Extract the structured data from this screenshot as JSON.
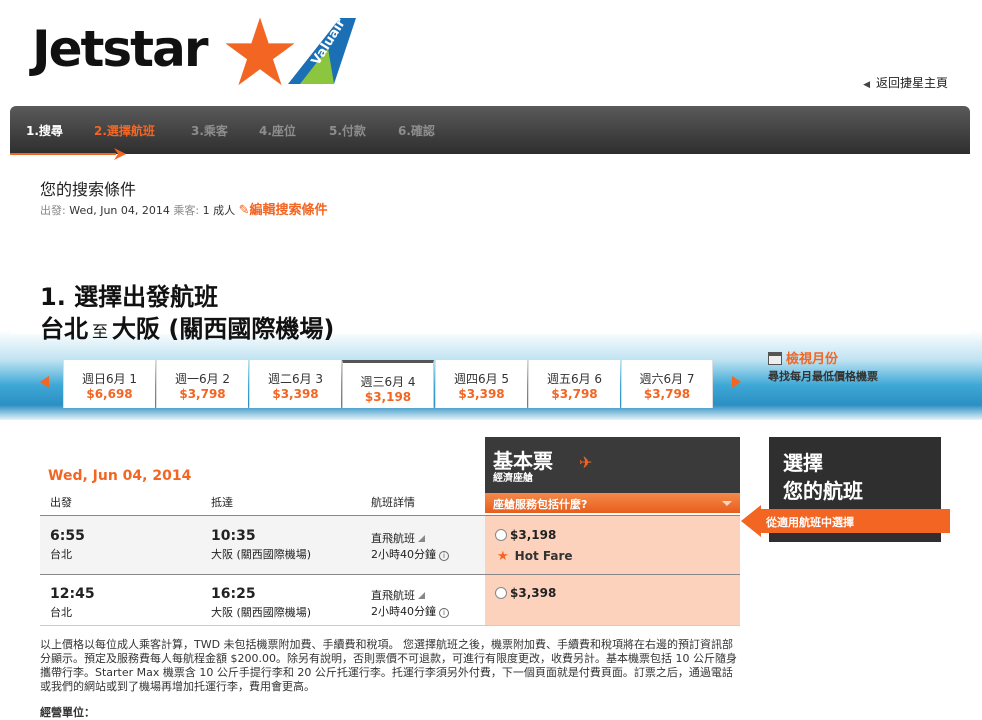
{
  "header": {
    "logo_text": "Jetstar",
    "partner_logo_text": "Valuair",
    "back_home": "返回捷星主頁"
  },
  "steps": [
    {
      "label": "1.搜尋",
      "state": "done"
    },
    {
      "label": "2.選擇航班",
      "state": "active"
    },
    {
      "label": "3.乘客",
      "state": "inactive"
    },
    {
      "label": "4.座位",
      "state": "inactive"
    },
    {
      "label": "5.付款",
      "state": "inactive"
    },
    {
      "label": "6.確認",
      "state": "inactive"
    }
  ],
  "search": {
    "title": "您的搜索條件",
    "depart_label": "出發:",
    "depart_value": "Wed, Jun 04, 2014",
    "pax_label": "乘客:",
    "pax_value": "1 成人",
    "edit_label": "編輯搜索條件"
  },
  "heading": {
    "line1": "1. 選擇出發航班",
    "origin": "台北",
    "to": "至",
    "destination": "大阪 (關西國際機場)"
  },
  "month_view": {
    "link": "檢視月份",
    "sub": "尋找每月最低價格機票"
  },
  "date_tabs": [
    {
      "day": "週日6月 1",
      "price": "$6,698"
    },
    {
      "day": "週一6月 2",
      "price": "$3,798"
    },
    {
      "day": "週二6月 3",
      "price": "$3,398"
    },
    {
      "day": "週三6月 4",
      "price": "$3,198",
      "selected": true
    },
    {
      "day": "週四6月 5",
      "price": "$3,398"
    },
    {
      "day": "週五6月 6",
      "price": "$3,798"
    },
    {
      "day": "週六6月 7",
      "price": "$3,798"
    }
  ],
  "flights": {
    "date": "Wed, Jun 04, 2014",
    "headers": {
      "depart": "出發",
      "arrive": "抵達",
      "details": "航班詳情"
    },
    "fare": {
      "title": "基本票",
      "subtitle": "經濟座艙",
      "bar": "座艙服務包括什麼?"
    },
    "rows": [
      {
        "dep_time": "6:55",
        "dep_city": "台北",
        "arr_time": "10:35",
        "arr_city": "大阪 (關西國際機場)",
        "type": "直飛航班",
        "duration": "2小時40分鐘",
        "price": "$3,198",
        "hot": "Hot Fare"
      },
      {
        "dep_time": "12:45",
        "dep_city": "台北",
        "arr_time": "16:25",
        "arr_city": "大阪 (關西國際機場)",
        "type": "直飛航班",
        "duration": "2小時40分鐘",
        "price": "$3,398",
        "hot": ""
      }
    ]
  },
  "choose": {
    "line1": "選擇",
    "line2": "您的航班",
    "bar": "從適用航班中選擇"
  },
  "note": "以上價格以每位成人乘客計算，TWD 未包括機票附加費、手續費和稅項。 您選擇航班之後，機票附加費、手續費和稅項將在右邊的預訂資訊部分顯示。預定及服務費每人每航程金額 $200.00。除另有說明，否則票價不可退款，可進行有限度更改，收費另計。基本機票包括 10 公斤隨身攜帶行李。Starter Max 機票含 10 公斤手提行李和 20 公斤托運行李。托運行李須另外付費，下一個頁面就是付費頁面。訂票之后，通過電話或我們的網站或到了機場再增加托運行李，費用會更高。",
  "note2": "經營單位：",
  "colors": {
    "accent": "#f26522",
    "dark": "#2f2f2f",
    "fare_bg": "#fcd2bd"
  }
}
